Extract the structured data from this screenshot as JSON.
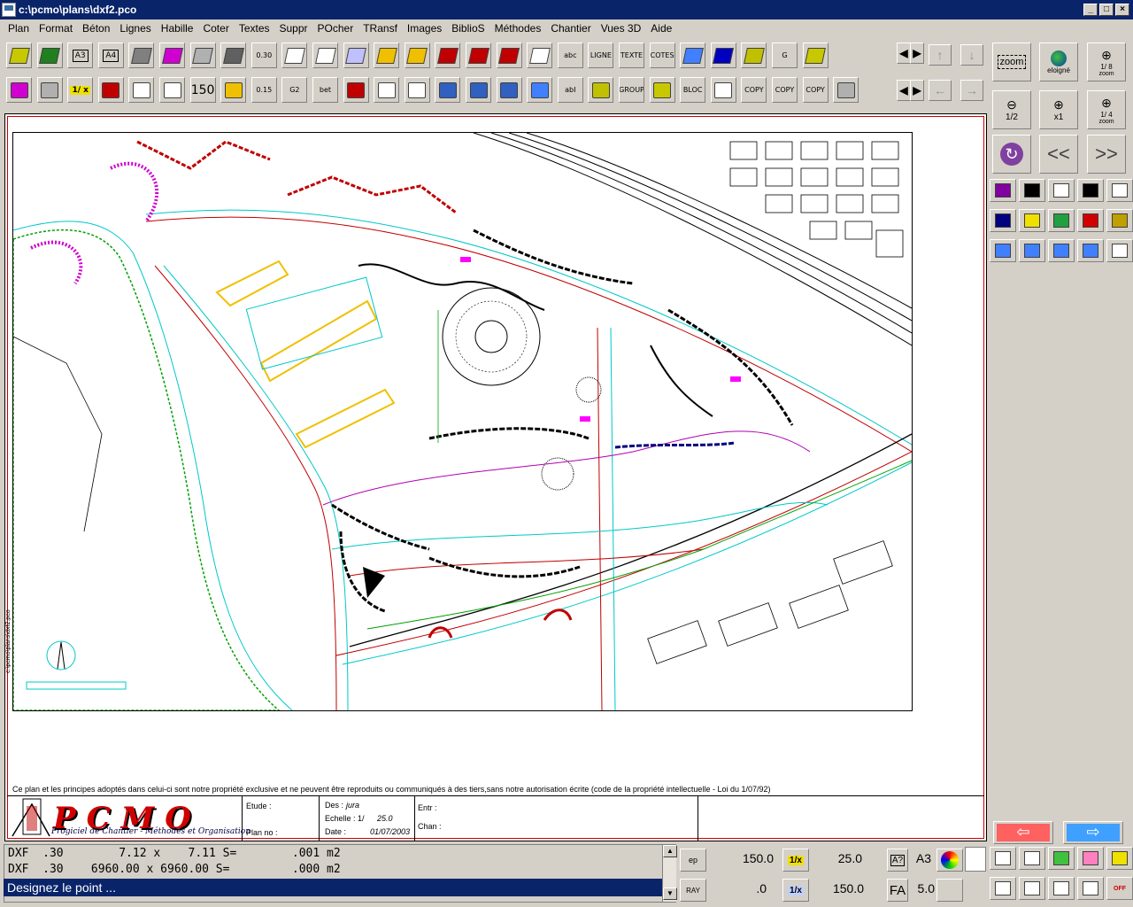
{
  "window": {
    "title": "c:\\pcmo\\plans\\dxf2.pco",
    "minimize": "_",
    "maximize": "□",
    "close": "×"
  },
  "menu": [
    "Plan",
    "Format",
    "Béton",
    "Lignes",
    "Habille",
    "Coter",
    "Textes",
    "Suppr",
    "POcher",
    "TRansf",
    "Images",
    "BiblioS",
    "Méthodes",
    "Chantier",
    "Vues 3D",
    "Aide"
  ],
  "toolbar": {
    "row1_labels": {
      "a3": "A3",
      "a4": "A4",
      "scale030": "0.30",
      "text_abc": "abc",
      "ligne": "LIGNE",
      "texte": "TEXTE",
      "cotes": "COTES",
      "g_label": "G"
    },
    "row2_labels": {
      "onex": "1/ x",
      "scale150": "150",
      "scale015": "0.15",
      "g2": "G2",
      "bet": "bet",
      "abi": "abI",
      "group": "GROUP",
      "bloc": "BLOC",
      "copy": "COPY"
    }
  },
  "zoom": {
    "zoom_label": "zoom",
    "eloigne": "eloigné",
    "zoom18": "1/ 8",
    "zoom_word": "zoom",
    "half": "1/2",
    "x1": "x1",
    "quarter": "1/ 4",
    "prev": "<<",
    "next": ">>"
  },
  "drawing": {
    "vertical_path": "c:\\pcmo\\plans\\dxf2.pco",
    "notice": "Ce plan et les principes adoptés dans celui-ci sont notre propriété exclusive et ne peuvent être reproduits ou communiqués à des tiers,sans notre autorisation écrite (code de la propriété intellectuelle - Loi du 1/07/92)"
  },
  "cartouche": {
    "logo": "PCMO",
    "logo_sub": "Progiciel de Chantier - Méthodes et Organisation",
    "etude": "Etude :",
    "plan_no": "Plan no :",
    "des": "Des :",
    "des_val": "jura",
    "echelle": "Echelle : 1/",
    "echelle_val": "25.0",
    "date": "Date :",
    "date_val": "01/07/2003",
    "entr": "Entr :",
    "chan": "Chan :"
  },
  "status": {
    "line1": "DXF  .30        7.12 x    7.11 S=        .001 m2",
    "line2": "DXF  .30    6960.00 x 6960.00 S=         .000 m2",
    "prompt": "Designez le point ..."
  },
  "bottom": {
    "ep": "ep",
    "val1": "150.0",
    "onex": "1/x",
    "val2": "25.0",
    "a_q": "A?",
    "a3": "A3",
    "ray": "RAY",
    "val3": ".0",
    "onex2": "1/x",
    "val4": "150.0",
    "fa": "FA",
    "val5": "5.0",
    "off": "OFF"
  }
}
